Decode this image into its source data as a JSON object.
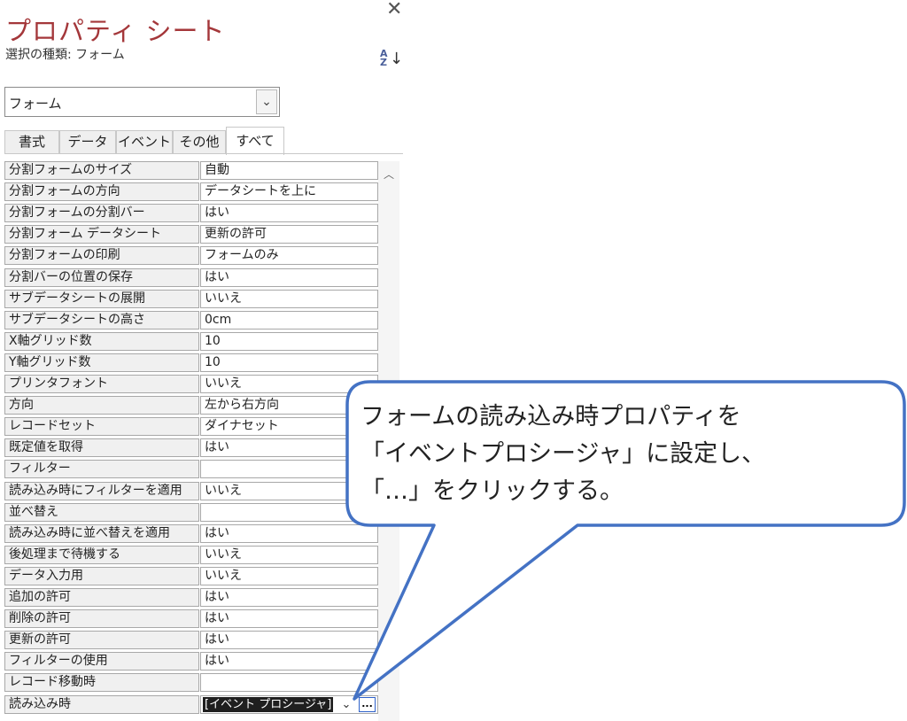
{
  "panel": {
    "title": "プロパティ シート",
    "close_glyph": "✕",
    "selection_label": "選択の種類: フォーム",
    "sort_icon": "az-sort-icon",
    "combo_value": "フォーム",
    "combo_chevron": "⌄",
    "tabs": [
      {
        "label": "書式"
      },
      {
        "label": "データ"
      },
      {
        "label": "イベント"
      },
      {
        "label": "その他"
      },
      {
        "label": "すべて",
        "active": true
      }
    ]
  },
  "properties": [
    {
      "name": "分割フォームのサイズ",
      "value": "自動"
    },
    {
      "name": "分割フォームの方向",
      "value": "データシートを上に"
    },
    {
      "name": "分割フォームの分割バー",
      "value": "はい"
    },
    {
      "name": "分割フォーム データシート",
      "value": "更新の許可"
    },
    {
      "name": "分割フォームの印刷",
      "value": "フォームのみ"
    },
    {
      "name": "分割バーの位置の保存",
      "value": "はい"
    },
    {
      "name": "サブデータシートの展開",
      "value": "いいえ"
    },
    {
      "name": "サブデータシートの高さ",
      "value": "0cm"
    },
    {
      "name": "X軸グリッド数",
      "value": "10"
    },
    {
      "name": "Y軸グリッド数",
      "value": "10"
    },
    {
      "name": "プリンタフォント",
      "value": "いいえ"
    },
    {
      "name": "方向",
      "value": "左から右方向"
    },
    {
      "name": "レコードセット",
      "value": "ダイナセット"
    },
    {
      "name": "既定値を取得",
      "value": "はい"
    },
    {
      "name": "フィルター",
      "value": ""
    },
    {
      "name": "読み込み時にフィルターを適用",
      "value": "いいえ"
    },
    {
      "name": "並べ替え",
      "value": ""
    },
    {
      "name": "読み込み時に並べ替えを適用",
      "value": "はい"
    },
    {
      "name": "後処理まで待機する",
      "value": "いいえ"
    },
    {
      "name": "データ入力用",
      "value": "いいえ"
    },
    {
      "name": "追加の許可",
      "value": "はい"
    },
    {
      "name": "削除の許可",
      "value": "はい"
    },
    {
      "name": "更新の許可",
      "value": "はい"
    },
    {
      "name": "フィルターの使用",
      "value": "はい"
    },
    {
      "name": "レコード移動時",
      "value": ""
    },
    {
      "name": "読み込み時",
      "value": "[イベント プロシージャ]"
    }
  ],
  "event_row": {
    "dropdown_glyph": "⌄",
    "builder_label": "..."
  },
  "callout": {
    "lines": [
      "フォームの読み込み時プロパティを",
      "「イベントプロシージャ」に設定し、",
      "「…」をクリックする。"
    ],
    "border_color": "#4472c4"
  }
}
